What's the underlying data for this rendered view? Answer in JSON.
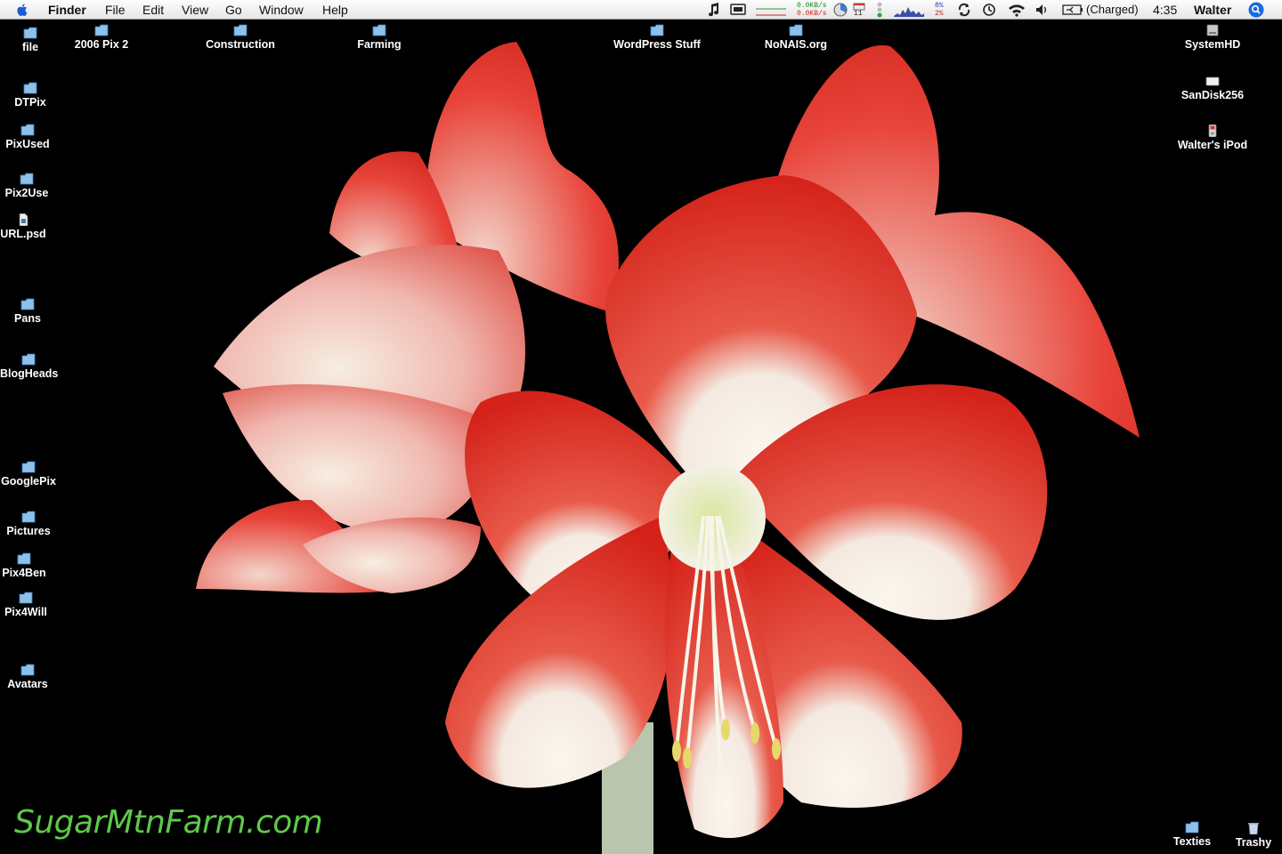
{
  "menubar": {
    "app_name": "Finder",
    "menus": [
      "File",
      "Edit",
      "View",
      "Go",
      "Window",
      "Help"
    ],
    "net_up": "0.0KB/s",
    "net_down": "0.0KB/s",
    "cal_day": "11",
    "cpu_top": "8%",
    "cpu_bottom": "2%",
    "battery_status": "(Charged)",
    "clock": "4:35",
    "user": "Walter",
    "icons": [
      "apple-icon",
      "itunes-note-icon",
      "display-icon",
      "net-graph-icon",
      "clock-pie-icon",
      "calendar-icon",
      "traffic-light-icon",
      "activity-graph-icon",
      "sync-icon",
      "time-machine-icon",
      "wifi-icon",
      "volume-icon",
      "battery-icon",
      "spotlight-icon"
    ]
  },
  "desktop": {
    "left_column": [
      {
        "label": "file",
        "icon": "folder-icon"
      },
      {
        "label": "DTPix",
        "icon": "folder-icon"
      },
      {
        "label": "PixUsed",
        "icon": "folder-icon"
      },
      {
        "label": "Pix2Use",
        "icon": "folder-icon"
      },
      {
        "label": "URL.psd",
        "icon": "document-icon"
      },
      {
        "label": "Pans",
        "icon": "folder-icon"
      },
      {
        "label": "BlogHeads",
        "icon": "folder-icon"
      },
      {
        "label": "GooglePix",
        "icon": "folder-icon"
      },
      {
        "label": "Pictures",
        "icon": "folder-icon"
      },
      {
        "label": "Pix4Ben",
        "icon": "folder-icon"
      },
      {
        "label": "Pix4Will",
        "icon": "folder-icon"
      },
      {
        "label": "Avatars",
        "icon": "folder-icon"
      }
    ],
    "top_row": [
      {
        "label": "2006 Pix 2",
        "icon": "folder-icon"
      },
      {
        "label": "Construction",
        "icon": "folder-icon"
      },
      {
        "label": "Farming",
        "icon": "folder-icon"
      },
      {
        "label": "WordPress Stuff",
        "icon": "folder-icon"
      },
      {
        "label": "NoNAIS.org",
        "icon": "folder-icon"
      }
    ],
    "right_column": [
      {
        "label": "SystemHD",
        "icon": "hard-drive-icon"
      },
      {
        "label": "SanDisk256",
        "icon": "usb-drive-icon"
      },
      {
        "label": "Walter's iPod",
        "icon": "ipod-icon"
      }
    ],
    "bottom_right": [
      {
        "label": "Texties",
        "icon": "folder-icon"
      },
      {
        "label": "Trashy",
        "icon": "trash-icon"
      }
    ]
  },
  "watermark": "SugarMtnFarm.com",
  "colors": {
    "petal_red": "#e0281e",
    "petal_white": "#f6f3ea",
    "background": "#000000",
    "watermark": "#5fc84a"
  }
}
